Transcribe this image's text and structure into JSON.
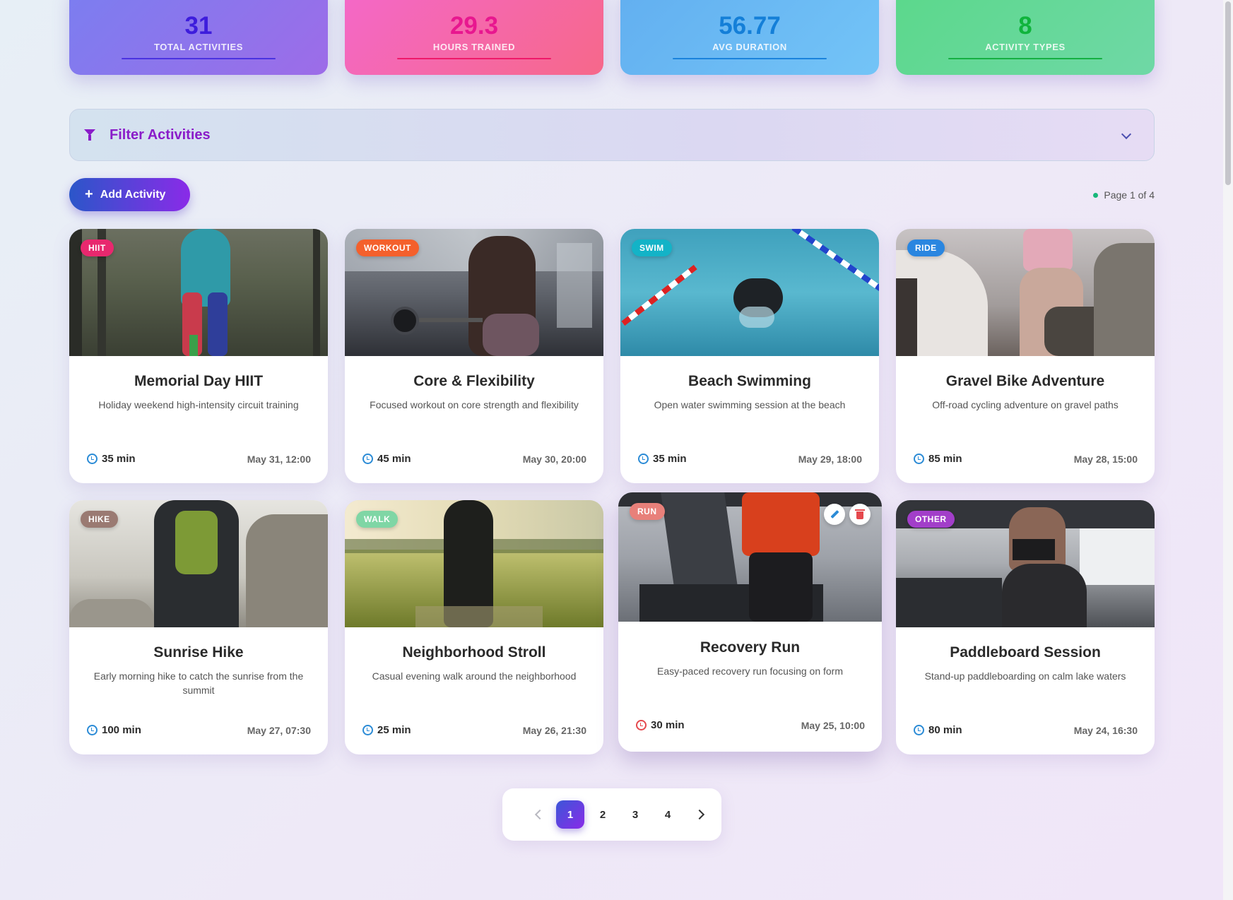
{
  "stats": [
    {
      "value": "31",
      "label": "TOTAL ACTIVITIES"
    },
    {
      "value": "29.3",
      "label": "HOURS TRAINED"
    },
    {
      "value": "56.77",
      "label": "AVG DURATION"
    },
    {
      "value": "8",
      "label": "ACTIVITY TYPES"
    }
  ],
  "filter": {
    "title": "Filter Activities"
  },
  "toolbar": {
    "add_label": "Add Activity",
    "page_info": "Page 1 of 4"
  },
  "cards": [
    {
      "badge": "HIIT",
      "badge_color": "#e8286e",
      "title": "Memorial Day HIIT",
      "desc": "Holiday weekend high-intensity circuit training",
      "duration": "35 min",
      "date": "May 31, 12:00"
    },
    {
      "badge": "WORKOUT",
      "badge_color": "#f4602c",
      "title": "Core & Flexibility",
      "desc": "Focused workout on core strength and flexibility",
      "duration": "45 min",
      "date": "May 30, 20:00"
    },
    {
      "badge": "SWIM",
      "badge_color": "#13b3c7",
      "title": "Beach Swimming",
      "desc": "Open water swimming session at the beach",
      "duration": "35 min",
      "date": "May 29, 18:00"
    },
    {
      "badge": "RIDE",
      "badge_color": "#2a86e0",
      "title": "Gravel Bike Adventure",
      "desc": "Off-road cycling adventure on gravel paths",
      "duration": "85 min",
      "date": "May 28, 15:00"
    },
    {
      "badge": "HIKE",
      "badge_color": "#9a7a72",
      "title": "Sunrise Hike",
      "desc": "Early morning hike to catch the sunrise from the summit",
      "duration": "100 min",
      "date": "May 27, 07:30"
    },
    {
      "badge": "WALK",
      "badge_color": "#7fd6a5",
      "title": "Neighborhood Stroll",
      "desc": "Casual evening walk around the neighborhood",
      "duration": "25 min",
      "date": "May 26, 21:30"
    },
    {
      "badge": "RUN",
      "badge_color": "#e8807a",
      "title": "Recovery Run",
      "desc": "Easy-paced recovery run focusing on form",
      "duration": "30 min",
      "date": "May 25, 10:00"
    },
    {
      "badge": "OTHER",
      "badge_color": "#a23ec9",
      "title": "Paddleboard Session",
      "desc": "Stand-up paddleboarding on calm lake waters",
      "duration": "80 min",
      "date": "May 24, 16:30"
    }
  ],
  "pagination": {
    "pages": [
      "1",
      "2",
      "3",
      "4"
    ],
    "current": "1"
  }
}
